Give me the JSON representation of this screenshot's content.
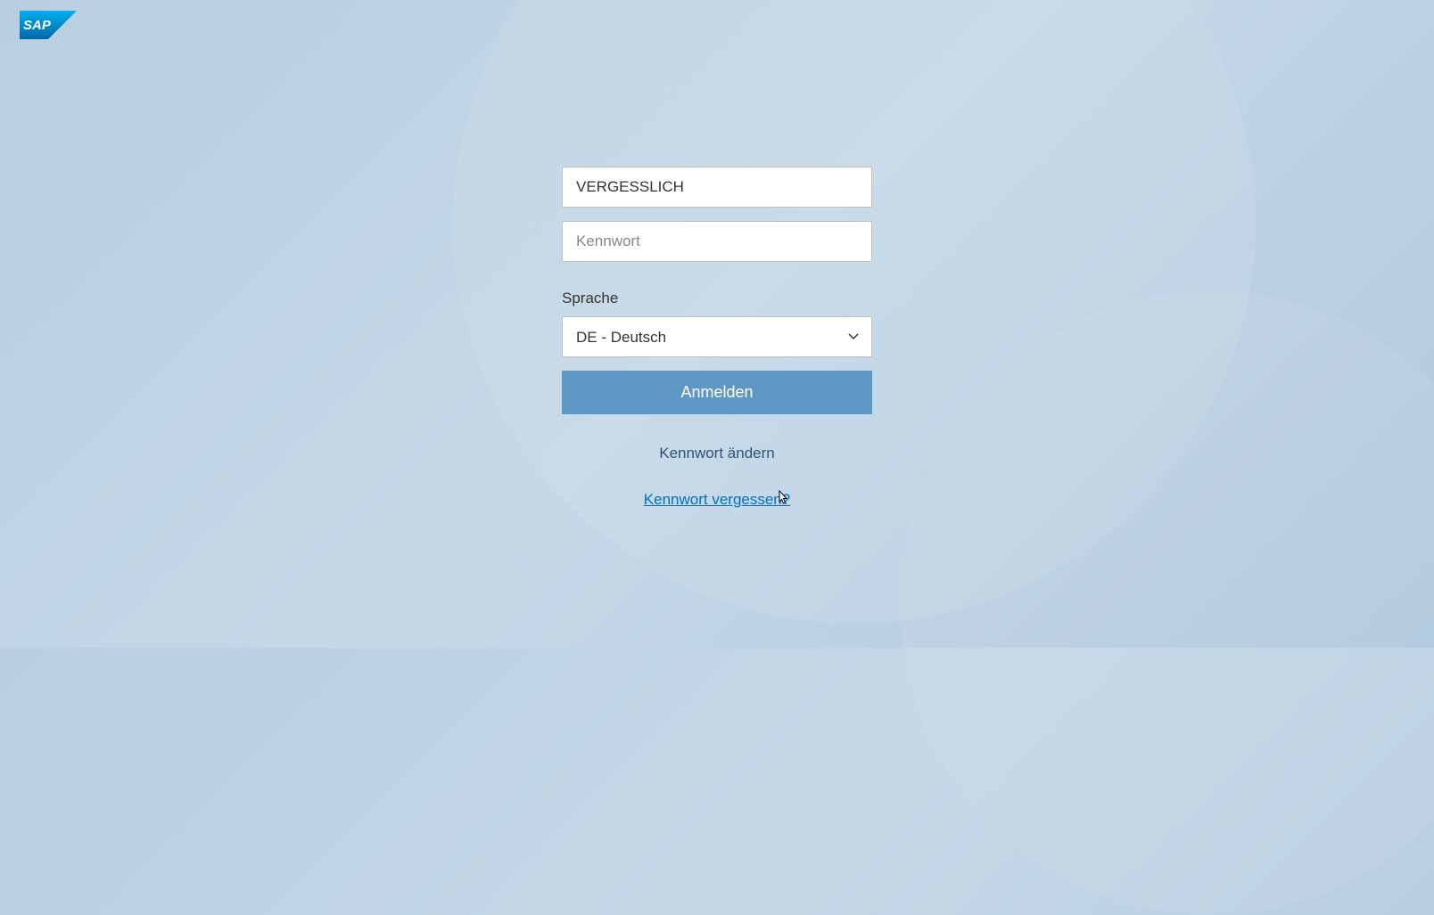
{
  "logo": {
    "name": "SAP"
  },
  "login": {
    "username_value": "VERGESSLICH",
    "password_placeholder": "Kennwort",
    "language_label": "Sprache",
    "language_selected": "DE - Deutsch",
    "submit_label": "Anmelden",
    "change_password_label": "Kennwort ändern",
    "forgot_password_label": "Kennwort vergessen?"
  },
  "colors": {
    "button_bg": "#5e97c4",
    "link_muted": "#2c5378",
    "link_active": "#0070c0"
  }
}
